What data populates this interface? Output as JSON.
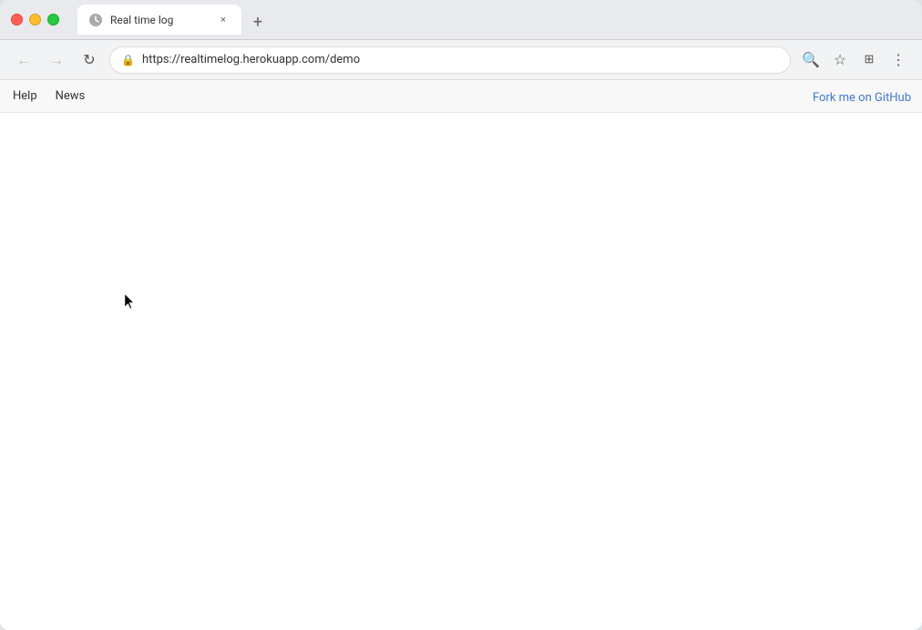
{
  "browser": {
    "tab": {
      "title": "Real time log",
      "favicon": "lock",
      "close_label": "×"
    },
    "new_tab_label": "+",
    "nav": {
      "back_label": "←",
      "forward_label": "→",
      "reload_label": "↻",
      "url": "https://realtimelog.herokuapp.com/demo",
      "lock_icon": "🔒"
    },
    "tools": {
      "search_label": "🔍",
      "bookmark_label": "☆",
      "extensions_label": "⚙",
      "menu_label": "⋮"
    }
  },
  "app": {
    "nav": {
      "help_label": "Help",
      "news_label": "News",
      "fork_label": "Fork me on GitHub"
    }
  }
}
